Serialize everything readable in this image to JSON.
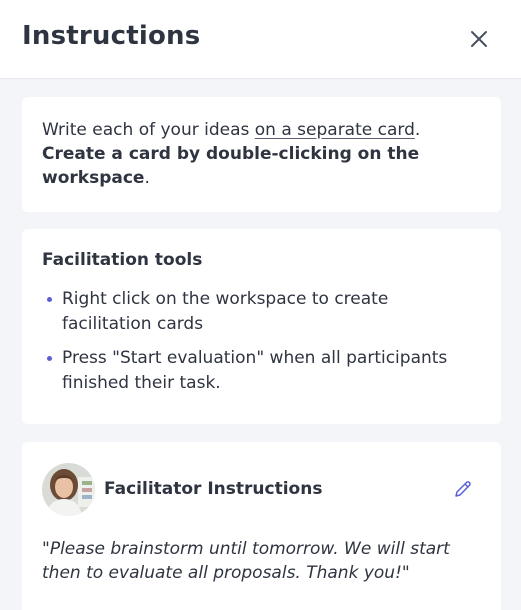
{
  "header": {
    "title": "Instructions",
    "close_icon": "close-icon"
  },
  "intro": {
    "part1": "Write each of your ideas ",
    "link": "on a separate card",
    "part2": ". ",
    "bold": "Create a card by double-clicking on the workspace",
    "part3": "."
  },
  "facilitation": {
    "title": "Facilitation tools",
    "items": [
      "Right click on the workspace to create facilitation cards",
      "Press \"Start evaluation\" when all participants finished their task."
    ]
  },
  "facilitator": {
    "title": "Facilitator Instructions",
    "edit_icon": "pencil-icon",
    "quote": "\"Please brainstorm until tomorrow. We will start then to evaluate all proposals. Thank you!\""
  },
  "colors": {
    "accent": "#5b5fd6",
    "text": "#2f3441",
    "background": "#f4f5f8"
  }
}
